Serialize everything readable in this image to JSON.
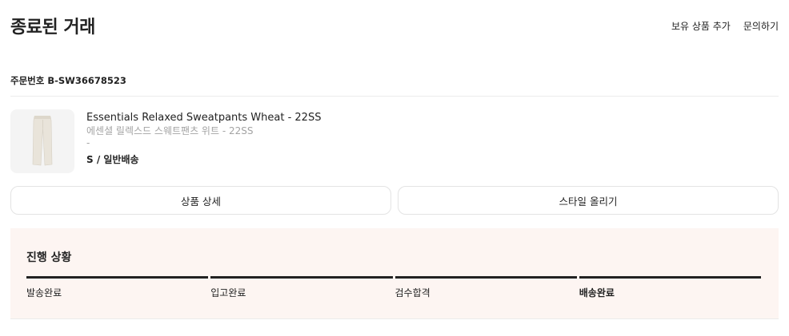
{
  "header": {
    "title": "종료된 거래",
    "links": [
      "보유 상품 추가",
      "문의하기"
    ]
  },
  "order": {
    "number_label": "주문번호 B-SW36678523"
  },
  "product": {
    "image_icon": "sweatpants-image",
    "name_en": "Essentials Relaxed Sweatpants Wheat - 22SS",
    "name_ko": "에센셜 릴렉스드 스웨트팬츠 위트 - 22SS",
    "extra": "-",
    "option": "S / 일반배송"
  },
  "buttons": {
    "detail": "상품 상세",
    "style": "스타일 올리기"
  },
  "progress": {
    "title": "진행 상황",
    "steps": [
      "발송완료",
      "입고완료",
      "검수합격",
      "배송완료"
    ],
    "current_step": "배송완료"
  }
}
